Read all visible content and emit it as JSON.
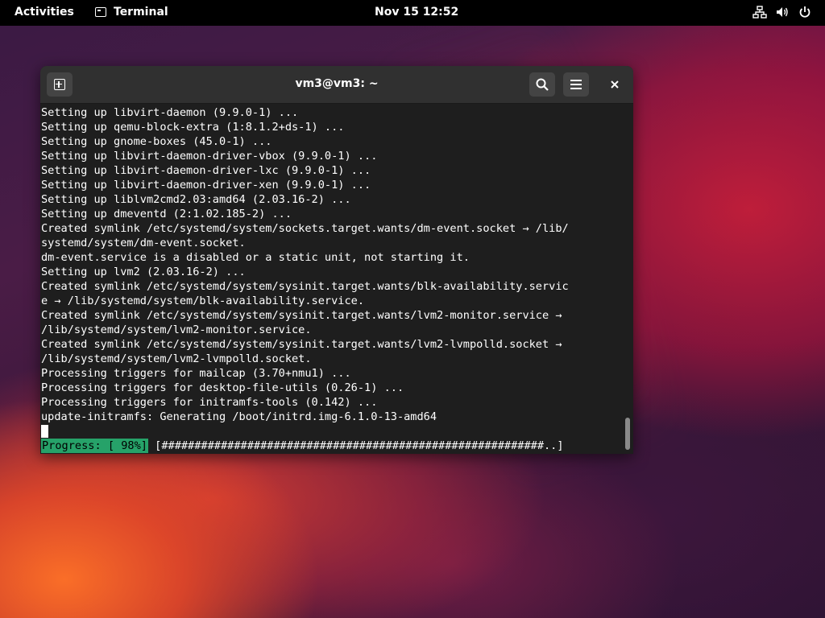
{
  "topbar": {
    "activities": "Activities",
    "app_name": "Terminal",
    "clock": "Nov 15  12:52",
    "icons": [
      "network-icon",
      "volume-icon",
      "power-icon"
    ]
  },
  "window": {
    "title": "vm3@vm3: ~",
    "buttons": [
      "new-tab",
      "search",
      "menu",
      "close"
    ]
  },
  "terminal": {
    "lines": [
      "Setting up libvirt-daemon (9.9.0-1) ...",
      "Setting up qemu-block-extra (1:8.1.2+ds-1) ...",
      "Setting up gnome-boxes (45.0-1) ...",
      "Setting up libvirt-daemon-driver-vbox (9.9.0-1) ...",
      "Setting up libvirt-daemon-driver-lxc (9.9.0-1) ...",
      "Setting up libvirt-daemon-driver-xen (9.9.0-1) ...",
      "Setting up liblvm2cmd2.03:amd64 (2.03.16-2) ...",
      "Setting up dmeventd (2:1.02.185-2) ...",
      "Created symlink /etc/systemd/system/sockets.target.wants/dm-event.socket → /lib/",
      "systemd/system/dm-event.socket.",
      "dm-event.service is a disabled or a static unit, not starting it.",
      "Setting up lvm2 (2.03.16-2) ...",
      "Created symlink /etc/systemd/system/sysinit.target.wants/blk-availability.servic",
      "e → /lib/systemd/system/blk-availability.service.",
      "Created symlink /etc/systemd/system/sysinit.target.wants/lvm2-monitor.service →",
      "/lib/systemd/system/lvm2-monitor.service.",
      "Created symlink /etc/systemd/system/sysinit.target.wants/lvm2-lvmpolld.socket →",
      "/lib/systemd/system/lvm2-lvmpolld.socket.",
      "Processing triggers for mailcap (3.70+nmu1) ...",
      "Processing triggers for desktop-file-utils (0.26-1) ...",
      "Processing triggers for initramfs-tools (0.142) ...",
      "update-initramfs: Generating /boot/initrd.img-6.1.0-13-amd64"
    ],
    "progress_label": "Progress: [ 98%]",
    "progress_bar": " [##########################################################..]",
    "progress_percent": 98
  },
  "colors": {
    "topbar_bg": "#000000",
    "terminal_bg": "#1e1e1e",
    "headerbar_bg": "#303030",
    "progress_green": "#26a269"
  }
}
